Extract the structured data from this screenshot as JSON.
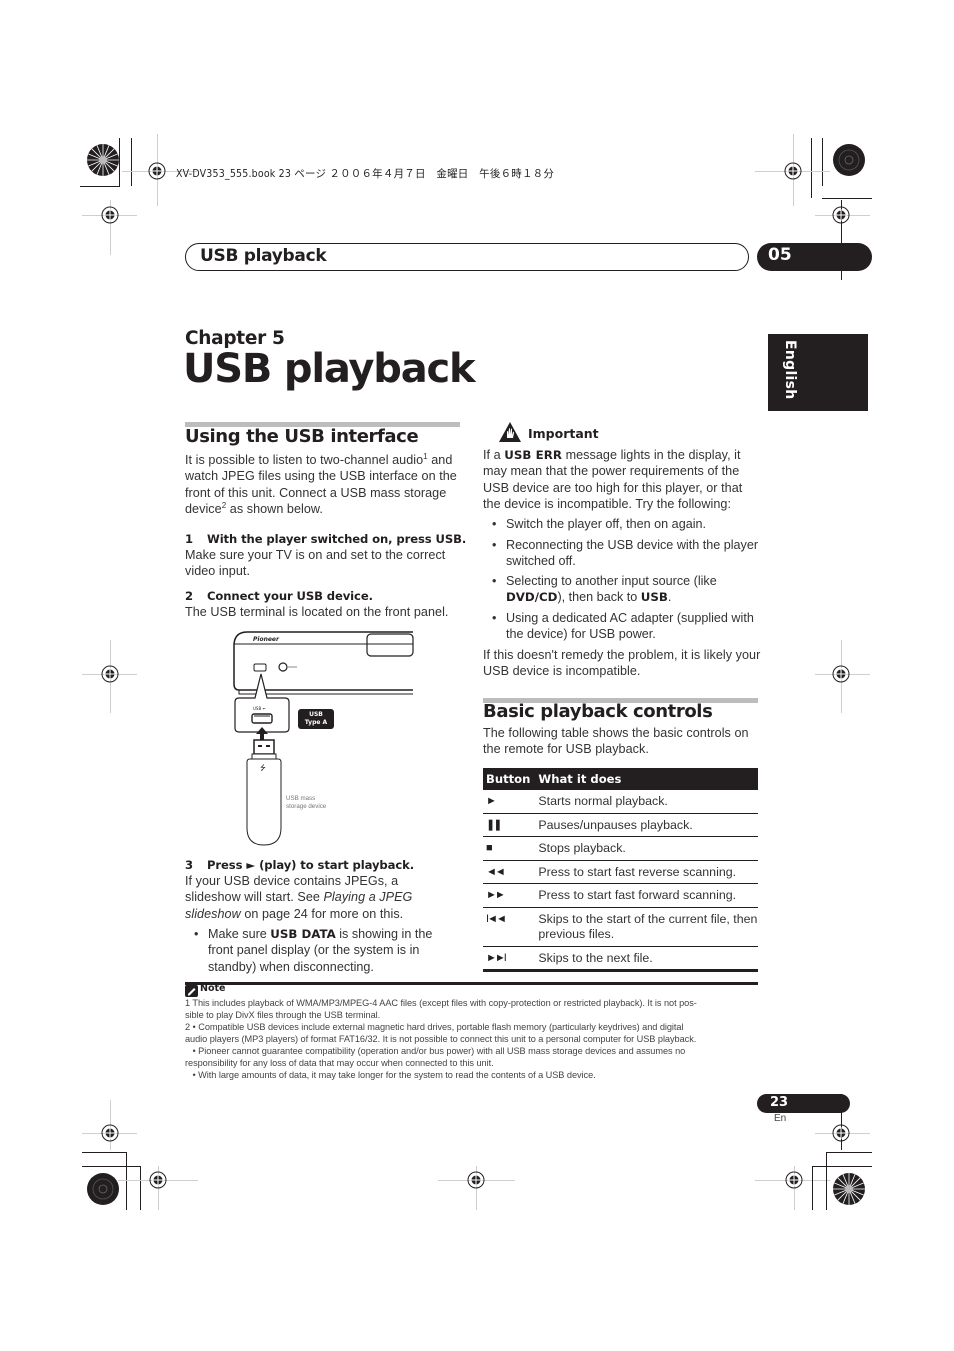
{
  "print_header": {
    "slug": "XV-DV353_555.book  23 ページ  ２００６年４月７日　金曜日　午後６時１８分"
  },
  "section_header": {
    "title": "USB playback",
    "chapter_number": "05"
  },
  "language_tab": "English",
  "chapter": {
    "label": "Chapter 5",
    "title": "USB playback"
  },
  "left_column": {
    "heading": "Using the USB interface",
    "intro": {
      "part1": "It is possible to listen to two-channel audio",
      "sup1": "1",
      "part2": "and watch JPEG files using the USB interface on the front of this unit. Connect a USB mass storage device",
      "sup2": "2",
      "part3": " as shown below."
    },
    "steps": [
      {
        "number": "1",
        "title": "With the player switched on, press USB.",
        "body": "Make sure your TV is on and set to the correct video input."
      },
      {
        "number": "2",
        "title": "Connect your USB device.",
        "body": "The USB terminal is located on the front panel."
      },
      {
        "number": "3",
        "title": "Press ► (play) to start playback.",
        "body_pre": "If your USB device contains JPEGs, a slideshow will start. See ",
        "body_italic": "Playing a JPEG slideshow",
        "body_post": " on page 24 for more on this."
      }
    ],
    "bullet": {
      "pre": "Make sure ",
      "bold": "USB DATA",
      "post": " is showing in the front panel display (or the system is in standby) when disconnecting."
    },
    "diagram": {
      "brand": "Pioneer",
      "port_badge_line1": "USB",
      "port_badge_line2": "Type A",
      "device_label_line1": "USB mass",
      "device_label_line2": "storage device"
    }
  },
  "right_column": {
    "important": {
      "title": "Important",
      "intro_pre": "If a ",
      "intro_bold": "USB ERR",
      "intro_post": " message lights in the display, it may mean that the power requirements of the USB device are too high for this player, or that the device is incompatible. Try the following:",
      "bullets": [
        {
          "text": "Switch the player off, then on again."
        },
        {
          "text": "Reconnecting the USB device with the player switched off."
        },
        {
          "pre": "Selecting to another input source (like ",
          "bold1": "DVD/CD",
          "mid": "), then back to ",
          "bold2": "USB",
          "post": "."
        },
        {
          "text": "Using a dedicated AC adapter (supplied with the device) for USB power."
        }
      ],
      "outro": "If this doesn't remedy the problem, it is likely your USB device is incompatible."
    },
    "controls": {
      "heading": "Basic playback controls",
      "intro": "The following table shows the basic controls on the remote for USB playback.",
      "columns": [
        "Button",
        "What it does"
      ],
      "rows": [
        {
          "button": "►",
          "icon": "play-icon",
          "action": "Starts normal playback."
        },
        {
          "button": "❚❚",
          "icon": "pause-icon",
          "action": "Pauses/unpauses playback."
        },
        {
          "button": "■",
          "icon": "stop-icon",
          "action": "Stops playback."
        },
        {
          "button": "◄◄",
          "icon": "fast-reverse-icon",
          "action": "Press to start fast reverse scanning."
        },
        {
          "button": "►►",
          "icon": "fast-forward-icon",
          "action": "Press to start fast forward scanning."
        },
        {
          "button": "I◄◄",
          "icon": "skip-previous-icon",
          "action": "Skips to the start of the current file, then previous files."
        },
        {
          "button": "►►I",
          "icon": "skip-next-icon",
          "action": "Skips to the next file."
        }
      ]
    }
  },
  "notes": {
    "title": "Note",
    "lines": [
      "1 This includes playback of WMA/MP3/MPEG-4 AAC files (except files with copy-protection or restricted playback). It is not pos-",
      "sible to play DivX files through the USB terminal.",
      "2  • Compatible USB devices include external magnetic hard drives, portable flash memory (particularly keydrives) and digital",
      "audio players (MP3 players) of format FAT16/32. It is not possible to connect this unit to a personal computer for USB playback.",
      "   • Pioneer cannot guarantee compatibility (operation and/or bus power) with all USB mass storage devices and assumes no",
      "responsibility for any loss of data that may occur when connected to this unit.",
      "   • With large amounts of data, it may take longer for the system to read the contents of a USB device."
    ]
  },
  "footer": {
    "page_number": "23",
    "language": "En"
  }
}
